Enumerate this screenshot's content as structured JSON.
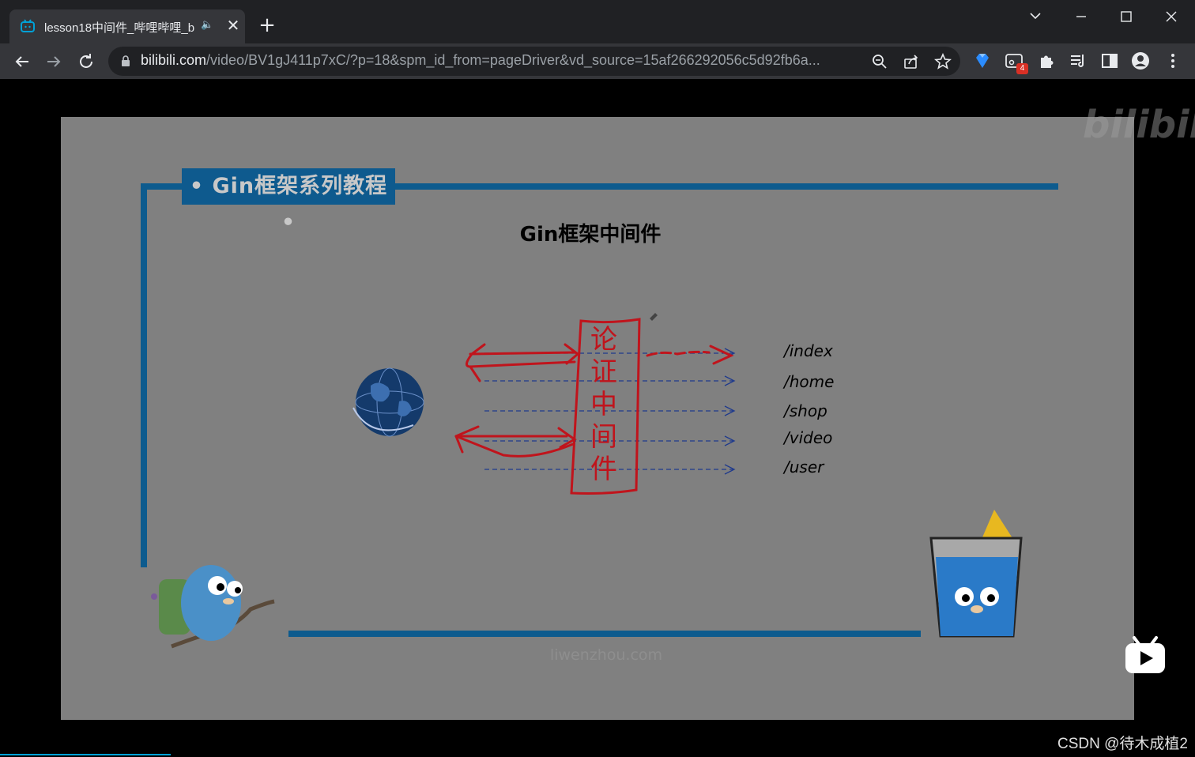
{
  "browser": {
    "tab_title": "lesson18中间件_哔哩哔哩_b",
    "tab_audio": "🔈",
    "url_host": "bilibili.com",
    "url_path": "/video/BV1gJ411p7xC/?p=18&spm_id_from=pageDriver&vd_source=15af266292056c5d92fb6a...",
    "extension_badge": "4"
  },
  "slide": {
    "banner": "• Gin框架系列教程 •",
    "title": "Gin框架中间件",
    "routes": [
      "/index",
      "/home",
      "/shop",
      "/video",
      "/user"
    ],
    "handwritten": [
      "论",
      "证",
      "中",
      "间",
      "件"
    ],
    "site": "liwenzhou.com"
  },
  "player": {
    "logo": "bilibili"
  },
  "watermark": "CSDN @待木成植2",
  "colors": {
    "frame_blue": "#0d5b8e",
    "ink_red": "#c0141c",
    "arrow_blue": "#1f3a8c"
  }
}
